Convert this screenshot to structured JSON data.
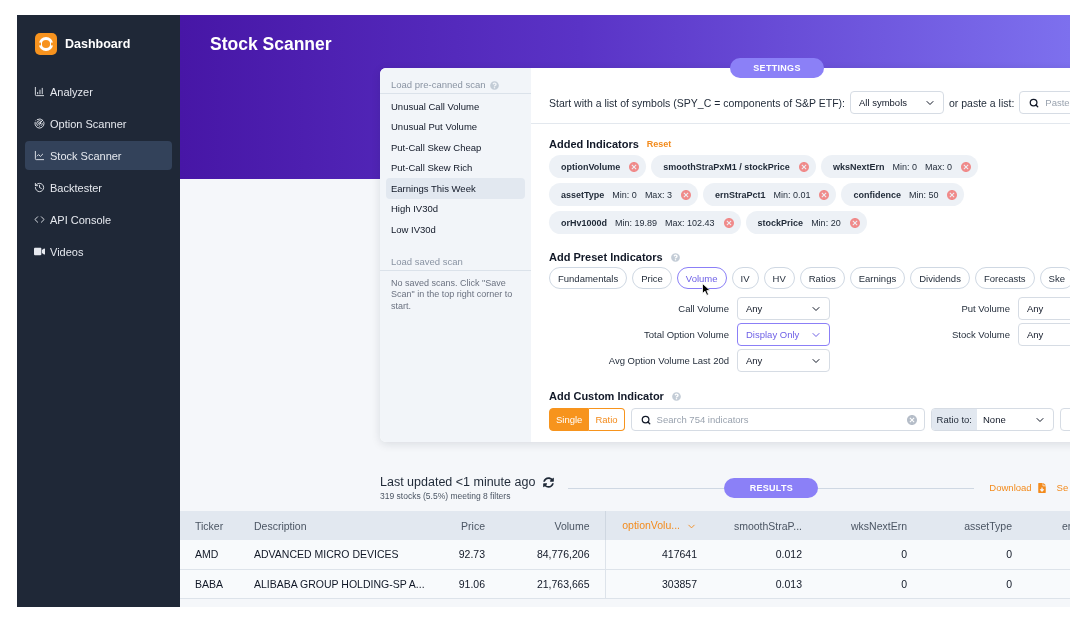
{
  "sidebar": {
    "brand": "Dashboard",
    "items": [
      {
        "label": "Analyzer",
        "selected": false
      },
      {
        "label": "Option Scanner",
        "selected": false
      },
      {
        "label": "Stock Scanner",
        "selected": true
      },
      {
        "label": "Backtester",
        "selected": false
      },
      {
        "label": "API Console",
        "selected": false
      },
      {
        "label": "Videos",
        "selected": false
      }
    ]
  },
  "header": {
    "title": "Stock Scanner"
  },
  "settings": {
    "badge": "SETTINGS",
    "precanned_scans": {
      "heading": "Load pre-canned scan",
      "items": [
        {
          "label": "Unusual Call Volume",
          "selected": false
        },
        {
          "label": "Unusual Put Volume",
          "selected": false
        },
        {
          "label": "Put-Call Skew Cheap",
          "selected": false
        },
        {
          "label": "Put-Call Skew Rich",
          "selected": false
        },
        {
          "label": "Earnings This Week",
          "selected": true
        },
        {
          "label": "High IV30d",
          "selected": false
        },
        {
          "label": "Low IV30d",
          "selected": false
        }
      ]
    },
    "saved_scans": {
      "heading": "Load saved scan",
      "message": "No saved scans. Click \"Save Scan\" in the top right corner to start."
    },
    "symbols": {
      "label": "Start with a list of symbols (SPY_C = components of S&P ETF):",
      "value": "All symbols",
      "paste_label": "or paste a list:",
      "paste_placeholder": "Paste"
    },
    "added_indicators": {
      "heading": "Added Indicators",
      "reset": "Reset",
      "items": [
        {
          "name": "optionVolume"
        },
        {
          "name": "smoothStraPxM1 / stockPrice"
        },
        {
          "name": "wksNextErn",
          "filters": [
            "Min: 0",
            "Max: 0"
          ]
        },
        {
          "name": "assetType",
          "filters": [
            "Min: 0",
            "Max: 3"
          ]
        },
        {
          "name": "ernStraPct1",
          "filters": [
            "Min: 0.01"
          ]
        },
        {
          "name": "confidence",
          "filters": [
            "Min: 50"
          ]
        },
        {
          "name": "orHv1000d",
          "filters": [
            "Min: 19.89",
            "Max: 102.43"
          ]
        },
        {
          "name": "stockPrice",
          "filters": [
            "Min: 20"
          ]
        }
      ]
    },
    "preset_indicators": {
      "heading": "Add Preset Indicators",
      "categories": [
        {
          "label": "Fundamentals",
          "selected": false
        },
        {
          "label": "Price",
          "selected": false
        },
        {
          "label": "Volume",
          "selected": true
        },
        {
          "label": "IV",
          "selected": false
        },
        {
          "label": "HV",
          "selected": false
        },
        {
          "label": "Ratios",
          "selected": false
        },
        {
          "label": "Earnings",
          "selected": false
        },
        {
          "label": "Dividends",
          "selected": false
        },
        {
          "label": "Forecasts",
          "selected": false
        },
        {
          "label": "Ske",
          "selected": false
        }
      ],
      "fields": [
        {
          "label": "Call Volume",
          "value": "Any",
          "active": false
        },
        {
          "label": "Put Volume",
          "value": "Any",
          "active": false
        },
        {
          "label": "Total Option Volume",
          "value": "Display Only",
          "active": true
        },
        {
          "label": "Stock Volume",
          "value": "Any",
          "active": false
        },
        {
          "label": "Avg Option Volume Last 20d",
          "value": "Any",
          "active": false
        }
      ]
    },
    "custom_indicator": {
      "heading": "Add Custom Indicator",
      "modes": [
        {
          "label": "Single",
          "selected": true
        },
        {
          "label": "Ratio",
          "selected": false
        }
      ],
      "search_placeholder": "Search 754 indicators",
      "ratio_label": "Ratio to:",
      "ratio_value": "None"
    }
  },
  "results": {
    "updated": "Last updated <1 minute ago",
    "summary": "319 stocks (5.5%) meeting 8 filters",
    "badge": "RESULTS",
    "download": "Download",
    "action_2": "Se",
    "columns": [
      {
        "label": "Ticker",
        "sorted": false
      },
      {
        "label": "Description",
        "sorted": false
      },
      {
        "label": "Price",
        "sorted": false
      },
      {
        "label": "Volume",
        "sorted": false
      },
      {
        "label": "optionVolu...",
        "sorted": true
      },
      {
        "label": "smoothStraP...",
        "sorted": false
      },
      {
        "label": "wksNextErn",
        "sorted": false
      },
      {
        "label": "assetType",
        "sorted": false
      },
      {
        "label": "er",
        "sorted": false
      }
    ],
    "rows": [
      [
        "AMD",
        "ADVANCED MICRO DEVICES",
        "92.73",
        "84,776,206",
        "417641",
        "0.012",
        "0",
        "0"
      ],
      [
        "BABA",
        "ALIBABA GROUP HOLDING-SP A...",
        "91.06",
        "21,763,665",
        "303857",
        "0.013",
        "0",
        "0"
      ]
    ]
  }
}
